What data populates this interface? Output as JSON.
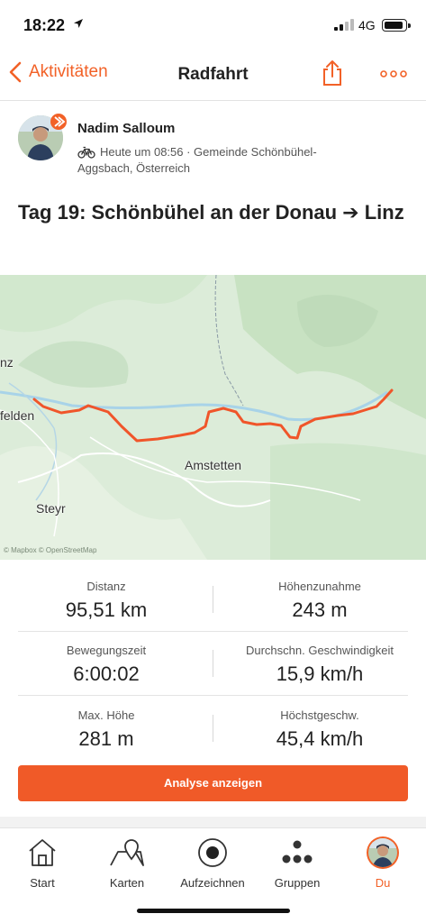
{
  "status_bar": {
    "time": "18:22",
    "network": "4G"
  },
  "nav": {
    "back_label": "Aktivitäten",
    "title": "Radfahrt"
  },
  "athlete": {
    "name": "Nadim Salloum",
    "meta": "Heute um 08:56 · Gemeinde Schönbühel-Aggsbach, Österreich"
  },
  "activity": {
    "title": "Tag 19: Schönbühel an der Donau ➔ Linz"
  },
  "map": {
    "labels": {
      "linz": "nz",
      "enns": "felden",
      "amstetten": "Amstetten",
      "steyr": "Steyr"
    },
    "attribution": "© Mapbox © OpenStreetMap",
    "route_color": "#f0552a"
  },
  "stats": [
    {
      "label": "Distanz",
      "value": "95,51 km"
    },
    {
      "label": "Höhenzunahme",
      "value": "243 m"
    },
    {
      "label": "Bewegungszeit",
      "value": "6:00:02"
    },
    {
      "label": "Durchschn. Geschwindigkeit",
      "value": "15,9 km/h"
    },
    {
      "label": "Max. Höhe",
      "value": "281 m"
    },
    {
      "label": "Höchstgeschw.",
      "value": "45,4 km/h"
    }
  ],
  "analyse_button": "Analyse anzeigen",
  "tabs": [
    {
      "label": "Start",
      "icon": "home-icon"
    },
    {
      "label": "Karten",
      "icon": "map-pin-icon"
    },
    {
      "label": "Aufzeichnen",
      "icon": "record-icon"
    },
    {
      "label": "Gruppen",
      "icon": "groups-icon"
    },
    {
      "label": "Du",
      "icon": "avatar"
    }
  ],
  "colors": {
    "accent": "#f26127",
    "button": "#f05a28"
  }
}
